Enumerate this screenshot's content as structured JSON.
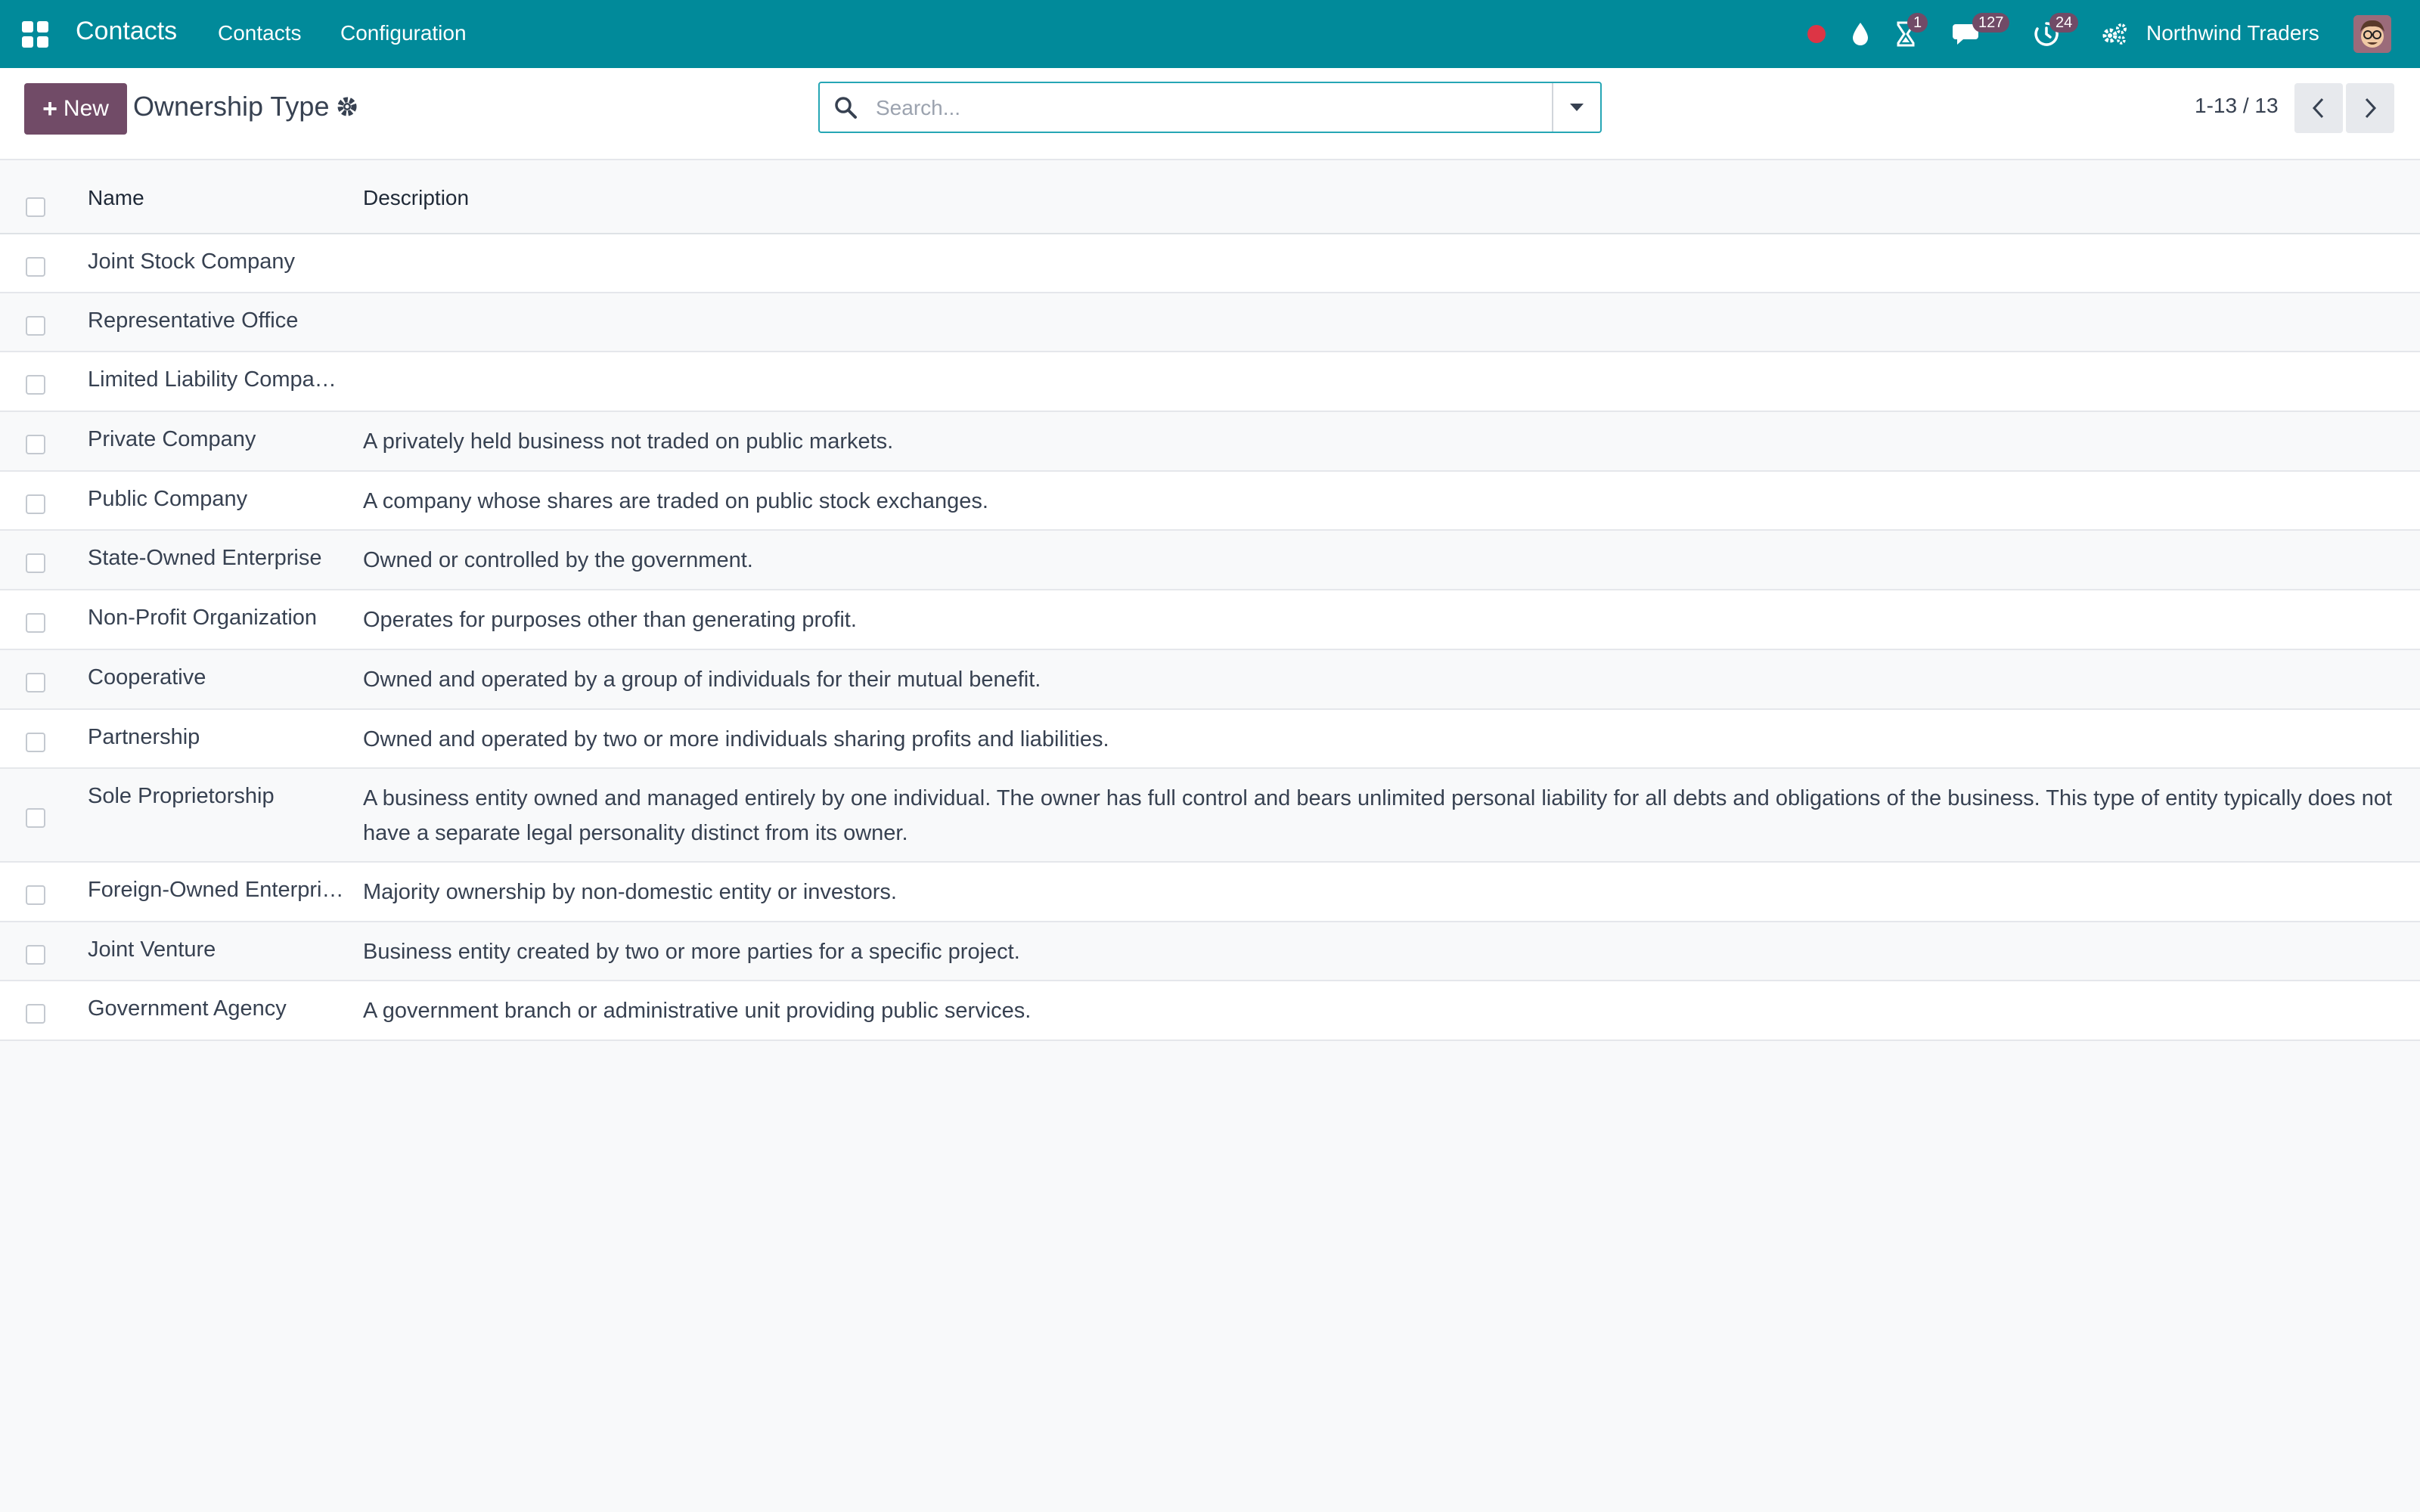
{
  "navbar": {
    "brand": "Contacts",
    "menu": [
      "Contacts",
      "Configuration"
    ],
    "badges": {
      "activities": "1",
      "messages": "127",
      "timer": "24"
    },
    "company": "Northwind Traders",
    "colors": {
      "navbar": "#018a9a",
      "accent": "#714b67",
      "status_dot": "#dc3545"
    }
  },
  "control_panel": {
    "new_label": "New",
    "title": "Ownership Type",
    "search_placeholder": "Search...",
    "pager": "1-13 / 13"
  },
  "list": {
    "columns": [
      "Name",
      "Description"
    ],
    "rows": [
      {
        "name": "Joint Stock Company",
        "description": ""
      },
      {
        "name": "Representative Office",
        "description": ""
      },
      {
        "name": "Limited Liability Compa…",
        "description": ""
      },
      {
        "name": "Private Company",
        "description": "A privately held business not traded on public markets."
      },
      {
        "name": "Public Company",
        "description": "A company whose shares are traded on public stock exchanges."
      },
      {
        "name": "State-Owned Enterprise",
        "description": "Owned or controlled by the government."
      },
      {
        "name": "Non-Profit Organization",
        "description": "Operates for purposes other than generating profit."
      },
      {
        "name": "Cooperative",
        "description": "Owned and operated by a group of individuals for their mutual benefit."
      },
      {
        "name": "Partnership",
        "description": "Owned and operated by two or more individuals sharing profits and liabilities."
      },
      {
        "name": "Sole Proprietorship",
        "description": "A business entity owned and managed entirely by one individual. The owner has full control and bears unlimited personal liability for all debts and obligations of the business. This type of entity typically does not have a separate legal personality distinct from its owner."
      },
      {
        "name": "Foreign-Owned Enterprise",
        "description": "Majority ownership by non-domestic entity or investors."
      },
      {
        "name": "Joint Venture",
        "description": "Business entity created by two or more parties for a specific project."
      },
      {
        "name": "Government Agency",
        "description": "A government branch or administrative unit providing public services."
      }
    ]
  }
}
